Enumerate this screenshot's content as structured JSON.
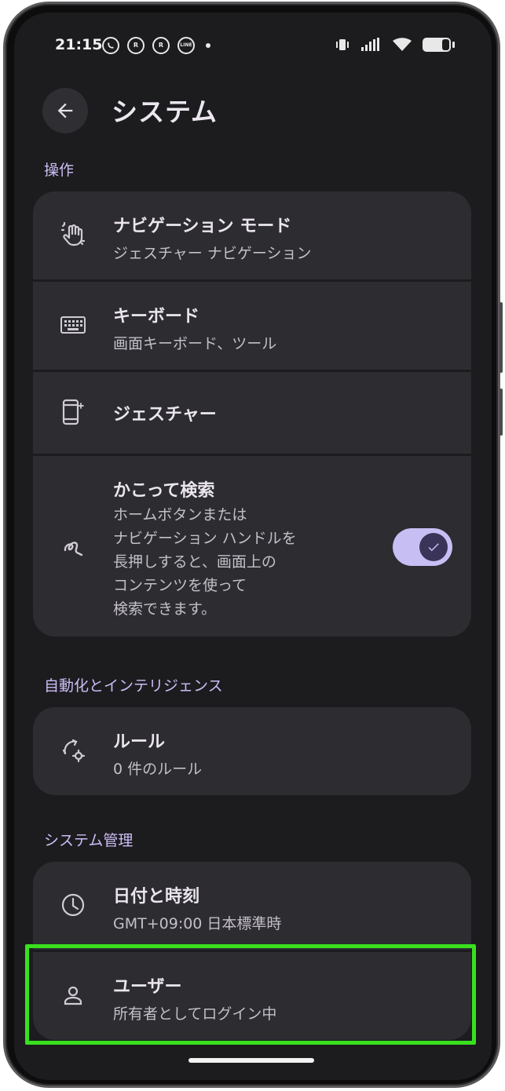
{
  "status_bar": {
    "time": "21:15",
    "app_icons": [
      {
        "name": "viber-icon",
        "text": ""
      },
      {
        "name": "rakuten-link-icon",
        "text": "R"
      },
      {
        "name": "rakuten-link-icon-2",
        "text": "R"
      },
      {
        "name": "line-icon",
        "text": "LINE"
      }
    ]
  },
  "header": {
    "title": "システム"
  },
  "sections": {
    "operation": {
      "header": "操作",
      "items": [
        {
          "title": "ナビゲーション モード",
          "subtitle": "ジェスチャー ナビゲーション"
        },
        {
          "title": "キーボード",
          "subtitle": "画面キーボード、ツール"
        },
        {
          "title": "ジェスチャー",
          "subtitle": ""
        },
        {
          "title": "かこって検索",
          "subtitle": "ホームボタンまたは\nナビゲーション ハンドルを\n長押しすると、画面上の\nコンテンツを使って\n検索できます。",
          "toggle_on": true
        }
      ]
    },
    "automation": {
      "header": "自動化とインテリジェンス",
      "items": [
        {
          "title": "ルール",
          "subtitle": "0 件のルール"
        }
      ]
    },
    "management": {
      "header": "システム管理",
      "items": [
        {
          "title": "日付と時刻",
          "subtitle": "GMT+09:00 日本標準時"
        },
        {
          "title": "ユーザー",
          "subtitle": "所有者としてログイン中"
        }
      ]
    }
  },
  "colors": {
    "background": "#1c1c1f",
    "card": "#2c2c31",
    "accent": "#cdbdf5",
    "toggle_track": "#c7bff3",
    "highlight": "#39e01d"
  }
}
